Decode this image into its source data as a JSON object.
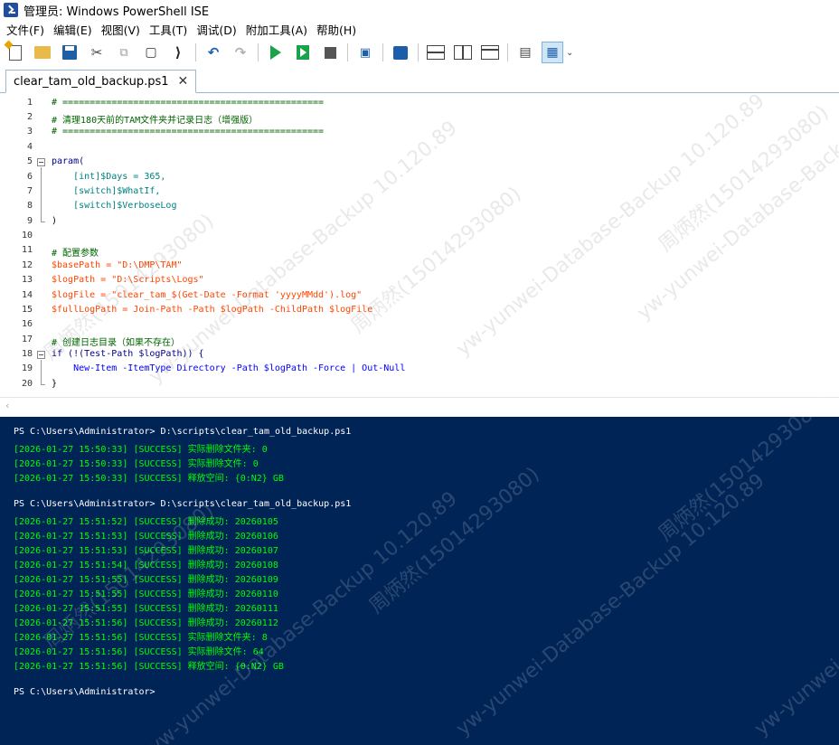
{
  "window": {
    "title": "管理员: Windows PowerShell ISE"
  },
  "menu": [
    "文件(F)",
    "编辑(E)",
    "视图(V)",
    "工具(T)",
    "调试(D)",
    "附加工具(A)",
    "帮助(H)"
  ],
  "toolbar": {
    "icons": [
      "new-script-icon",
      "open-icon",
      "save-icon",
      "cut-icon",
      "copy-icon",
      "paste-icon",
      "console-icon",
      "undo-icon",
      "redo-icon",
      "run-icon",
      "run-selection-icon",
      "stop-icon",
      "remote-icon",
      "powershell-icon",
      "layout-top-icon",
      "layout-right-icon",
      "layout-max-icon",
      "show-commands-icon",
      "addon-pane-icon",
      "overflow-icon"
    ],
    "overflow": "⌄"
  },
  "tab": {
    "label": "clear_tam_old_backup.ps1",
    "close": "✕"
  },
  "editor": {
    "line_numbers": [
      "1",
      "2",
      "3",
      "4",
      "5",
      "6",
      "7",
      "8",
      "9",
      "10",
      "11",
      "12",
      "13",
      "14",
      "15",
      "16",
      "17",
      "18",
      "19",
      "20"
    ],
    "lines": [
      "# ================================================",
      "# 清理180天前的TAM文件夹并记录日志（增强版）",
      "# ================================================",
      "",
      "param(",
      "    [int]$Days = 365,",
      "    [switch]$WhatIf,",
      "    [switch]$VerboseLog",
      ")",
      "",
      "# 配置参数",
      "$basePath = \"D:\\DMP\\TAM\"",
      "$logPath = \"D:\\Scripts\\Logs\"",
      "$logFile = \"clear_tam_$(Get-Date -Format 'yyyyMMdd').log\"",
      "$fullLogPath = Join-Path -Path $logPath -ChildPath $logFile",
      "",
      "# 创建日志目录（如果不存在）",
      "if (!(Test-Path $logPath)) {",
      "    New-Item -ItemType Directory -Path $logPath -Force | Out-Null",
      "}"
    ]
  },
  "console": {
    "lines": [
      "PS C:\\Users\\Administrator> D:\\scripts\\clear_tam_old_backup.ps1",
      "[2026-01-27 15:50:33] [SUCCESS] 实际删除文件夹: 0",
      "[2026-01-27 15:50:33] [SUCCESS] 实际删除文件: 0",
      "[2026-01-27 15:50:33] [SUCCESS] 释放空间: {0:N2} GB",
      "",
      "PS C:\\Users\\Administrator> D:\\scripts\\clear_tam_old_backup.ps1",
      "[2026-01-27 15:51:52] [SUCCESS] 删除成功: 20260105",
      "[2026-01-27 15:51:53] [SUCCESS] 删除成功: 20260106",
      "[2026-01-27 15:51:53] [SUCCESS] 删除成功: 20260107",
      "[2026-01-27 15:51:54] [SUCCESS] 删除成功: 20260108",
      "[2026-01-27 15:51:55] [SUCCESS] 删除成功: 20260109",
      "[2026-01-27 15:51:55] [SUCCESS] 删除成功: 20260110",
      "[2026-01-27 15:51:55] [SUCCESS] 删除成功: 20260111",
      "[2026-01-27 15:51:56] [SUCCESS] 删除成功: 20260112",
      "[2026-01-27 15:51:56] [SUCCESS] 实际删除文件夹: 8",
      "[2026-01-27 15:51:56] [SUCCESS] 实际删除文件: 64",
      "[2026-01-27 15:51:56] [SUCCESS] 释放空间: {0:N2} GB",
      "",
      "PS C:\\Users\\Administrator>"
    ]
  },
  "watermark": {
    "name": "周炳然(15014293080)",
    "tag": "yw-yunwei-Database-Backup 10.120.89"
  },
  "colors": {
    "console_bg": "#012456",
    "console_success": "#00ff00",
    "console_prompt": "#ffffff",
    "comment": "#006400",
    "variable": "#ff4500",
    "string": "#8b0000",
    "keyword": "#00008b",
    "command": "#0000ff",
    "type": "#008080",
    "number": "#800080"
  }
}
